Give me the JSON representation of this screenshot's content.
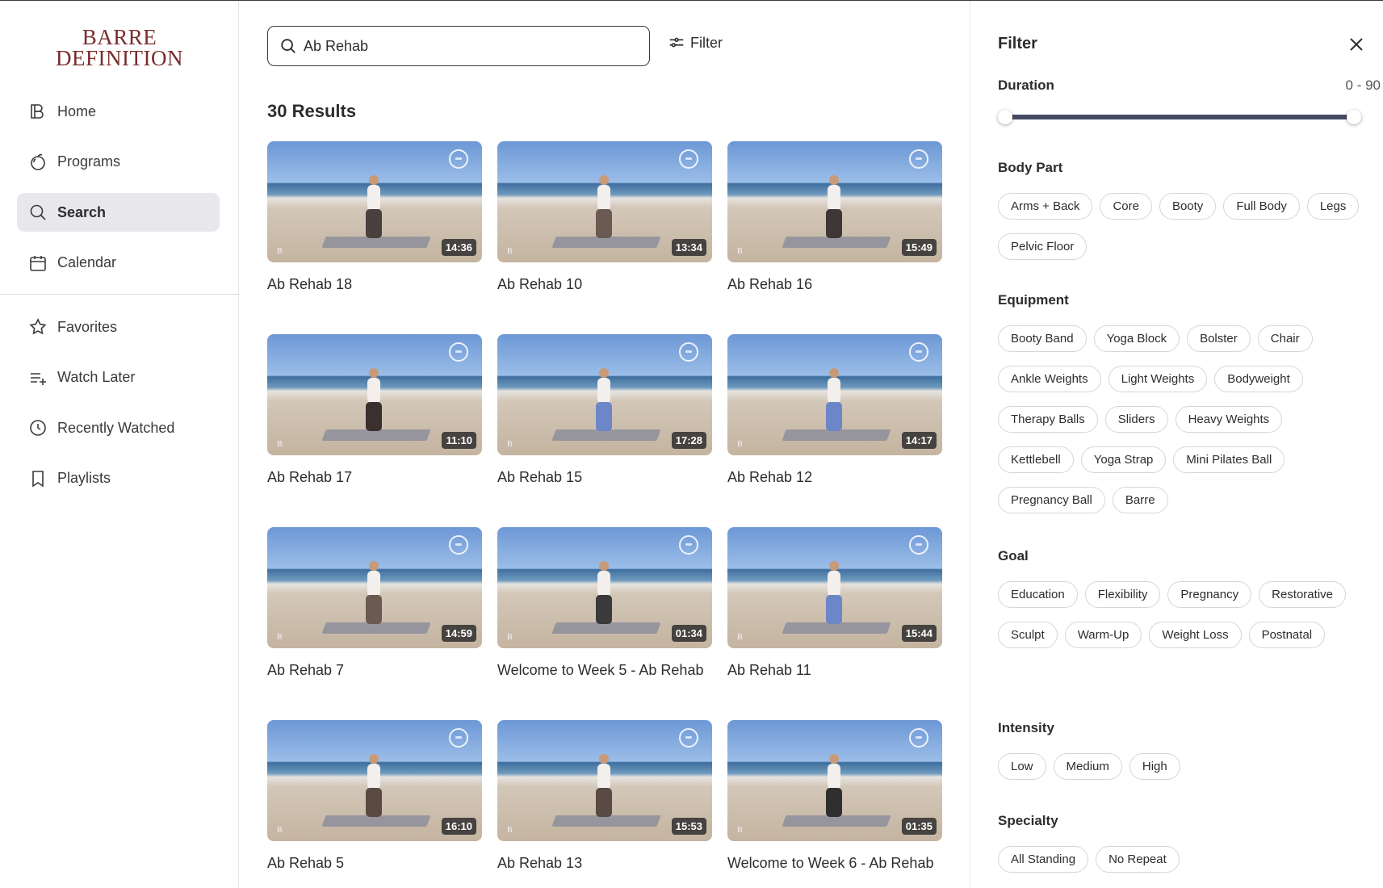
{
  "brand": {
    "line1": "BARRE",
    "line2": "DEFINITION"
  },
  "sidebar": {
    "primary": [
      {
        "label": "Home",
        "icon": "home-logo-icon",
        "active": false
      },
      {
        "label": "Programs",
        "icon": "programs-icon",
        "active": false
      },
      {
        "label": "Search",
        "icon": "search-icon",
        "active": true
      },
      {
        "label": "Calendar",
        "icon": "calendar-icon",
        "active": false
      }
    ],
    "secondary": [
      {
        "label": "Favorites",
        "icon": "star-icon"
      },
      {
        "label": "Watch Later",
        "icon": "playlist-add-icon"
      },
      {
        "label": "Recently Watched",
        "icon": "clock-icon"
      },
      {
        "label": "Playlists",
        "icon": "bookmark-icon"
      }
    ]
  },
  "search": {
    "value": "Ab Rehab",
    "filter_label": "Filter"
  },
  "results": {
    "count_label": "30 Results",
    "items": [
      {
        "title": "Ab Rehab 18",
        "duration": "14:36"
      },
      {
        "title": "Ab Rehab 10",
        "duration": "13:34"
      },
      {
        "title": "Ab Rehab 16",
        "duration": "15:49"
      },
      {
        "title": "Ab Rehab 17",
        "duration": "11:10"
      },
      {
        "title": "Ab Rehab 15",
        "duration": "17:28"
      },
      {
        "title": "Ab Rehab 12",
        "duration": "14:17"
      },
      {
        "title": "Ab Rehab 7",
        "duration": "14:59"
      },
      {
        "title": "Welcome to Week 5 - Ab Rehab",
        "duration": "01:34"
      },
      {
        "title": "Ab Rehab 11",
        "duration": "15:44"
      },
      {
        "title": "Ab Rehab 5",
        "duration": "16:10"
      },
      {
        "title": "Ab Rehab 13",
        "duration": "15:53"
      },
      {
        "title": "Welcome to Week 6 - Ab Rehab",
        "duration": "01:35"
      }
    ]
  },
  "filter": {
    "title": "Filter",
    "duration": {
      "label": "Duration",
      "range_label": "0 - 90",
      "min": 0,
      "max": 90
    },
    "sections": [
      {
        "title": "Body Part",
        "chips": [
          "Arms + Back",
          "Core",
          "Booty",
          "Full Body",
          "Legs",
          "Pelvic Floor"
        ]
      },
      {
        "title": "Equipment",
        "chips": [
          "Booty Band",
          "Yoga Block",
          "Bolster",
          "Chair",
          "Ankle Weights",
          "Light Weights",
          "Bodyweight",
          "Therapy Balls",
          "Sliders",
          "Heavy Weights",
          "Kettlebell",
          "Yoga Strap",
          "Mini Pilates Ball",
          "Pregnancy Ball",
          "Barre"
        ]
      },
      {
        "title": "Goal",
        "chips": [
          "Education",
          "Flexibility",
          "Pregnancy",
          "Restorative",
          "Sculpt",
          "Warm-Up",
          "Weight Loss",
          "Postnatal"
        ]
      },
      {
        "title": "Intensity",
        "chips": [
          "Low",
          "Medium",
          "High"
        ]
      },
      {
        "title": "Specialty",
        "chips": [
          "All Standing",
          "No Repeat"
        ]
      }
    ]
  },
  "colors": {
    "brand": "#7b2d2d",
    "slider_track": "#464a63",
    "active_nav_bg": "#e8e8ec"
  }
}
